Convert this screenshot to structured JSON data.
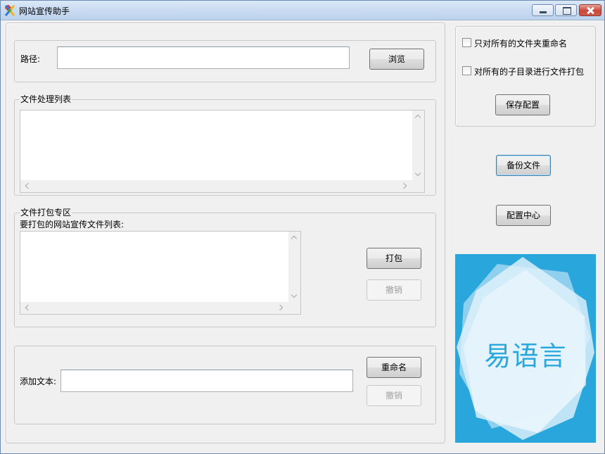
{
  "window": {
    "title": "网站宣传助手",
    "icon": "app-icon"
  },
  "path_section": {
    "label": "路径:",
    "value": "",
    "browse_label": "浏览"
  },
  "file_list_section": {
    "legend": "文件处理列表",
    "items": []
  },
  "pack_section": {
    "legend": "文件打包专区",
    "list_label": "要打包的网站宣传文件列表:",
    "items": [],
    "pack_label": "打包",
    "undo_label": "撤销"
  },
  "rename_section": {
    "add_text_label": "添加文本:",
    "value": "",
    "rename_label": "重命名",
    "undo_label": "撤销"
  },
  "options": {
    "only_rename_folders_label": "只对所有的文件夹重命名",
    "only_rename_folders_checked": false,
    "pack_subdirs_label": "对所有的子目录进行文件打包",
    "pack_subdirs_checked": false,
    "save_config_label": "保存配置"
  },
  "right_actions": {
    "backup_label": "备份文件",
    "config_center_label": "配置中心"
  },
  "logo": {
    "text": "易语言",
    "bg_color": "#29a6dc"
  }
}
